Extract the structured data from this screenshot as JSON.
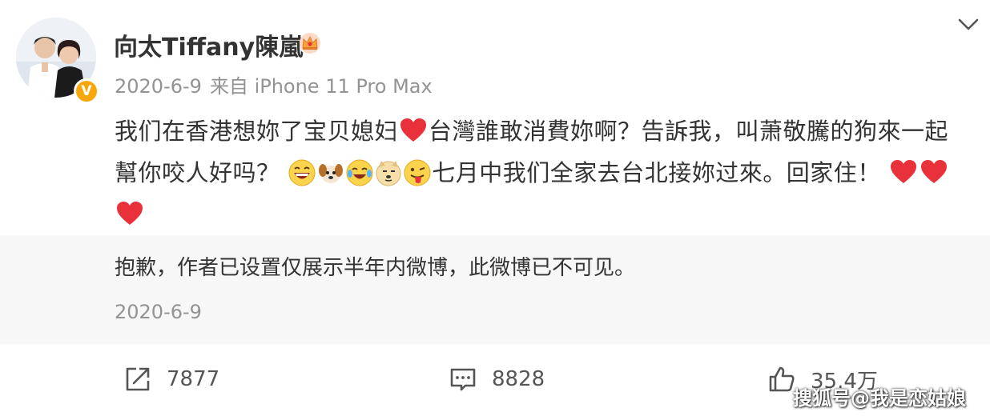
{
  "post": {
    "author": "向太Tiffany陳嵐",
    "date": "2020-6-9",
    "source": "来自 iPhone 11 Pro Max",
    "content": {
      "line1_a": "我们在香港想妳了宝贝媳妇",
      "line1_b": "台灣誰敢消費妳啊？告訴我，叫萧敬騰的狗來一起",
      "line2_a": "幫你咬人好吗？",
      "line2_b": "七月中我们全家去台北接妳过來。回家住！"
    },
    "icons": {
      "verified": "verified-v-badge",
      "crown": "crown-icon",
      "more": "chevron-down-icon",
      "emojis": [
        "grinning-emoji",
        "dog-emoji",
        "tears-of-joy-emoji",
        "doge-emoji",
        "tongue-out-emoji",
        "heart-emoji"
      ]
    }
  },
  "notice": {
    "text": "抱歉，作者已设置仅展示半年内微博，此微博已不可见。",
    "date": "2020-6-9"
  },
  "actions": {
    "repost_count": "7877",
    "comment_count": "8828",
    "like_count": "35.4万"
  },
  "watermark": "搜狐号@我是恋姑娘",
  "colors": {
    "badge": "#f7a70a",
    "heart": "#e8313b",
    "muted_text": "#939393",
    "notice_bg": "#f7f7f7"
  }
}
